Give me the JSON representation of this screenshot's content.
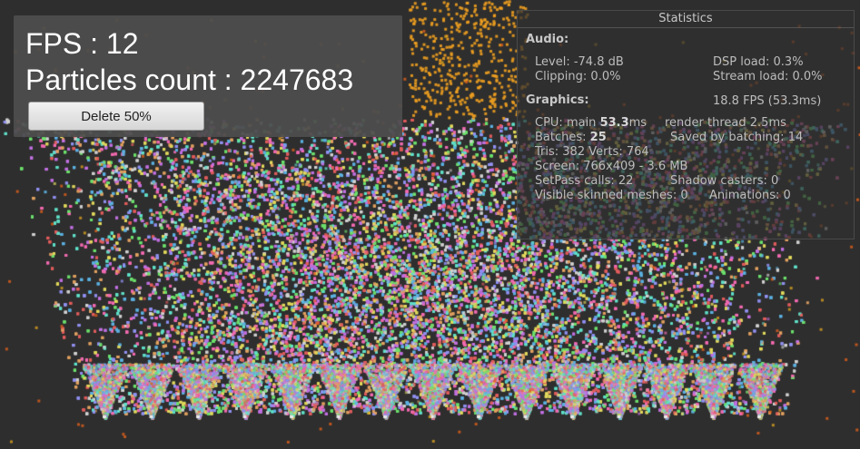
{
  "hud": {
    "fps_label": "FPS : 12",
    "particles_label": "Particles count : 2247683",
    "delete_button": "Delete 50%"
  },
  "stats": {
    "title": "Statistics",
    "audio_header": "Audio:",
    "level": "Level: -74.8 dB",
    "dsp_load": "DSP load: 0.3%",
    "clipping": "Clipping: 0.0%",
    "stream_load": "Stream load: 0.0%",
    "graphics_header": "Graphics:",
    "graphics_fps": "18.8 FPS (53.3ms)",
    "cpu_main_label": "CPU: main ",
    "cpu_main_value": "53.3",
    "cpu_main_unit": "ms",
    "render_thread": "render thread 2.5ms",
    "batches_label": "Batches: ",
    "batches_value": "25",
    "saved_by_batching": "Saved by batching: 14",
    "tris_verts": "Tris: 382  Verts: 764",
    "screen": "Screen: 766x409 - 3.6 MB",
    "setpass": "SetPass calls: 22",
    "shadow_casters": "Shadow casters: 0",
    "visible_skinned": "Visible skinned meshes: 0",
    "animations": "Animations: 0"
  },
  "colors": {
    "background": "#2e2e2e",
    "hud_panel": "#4e4e4e",
    "stream_orange": "#f0a020",
    "particle_palette": [
      "#e05c5c",
      "#5cb0e0",
      "#6ce06c",
      "#e0d85c",
      "#c070e0",
      "#e0a060",
      "#60e0c8",
      "#9090f0",
      "#d0d0d0",
      "#f06ab0"
    ]
  },
  "scene": {
    "emitter_count": 15,
    "particle_style": "multicolor-squares"
  }
}
